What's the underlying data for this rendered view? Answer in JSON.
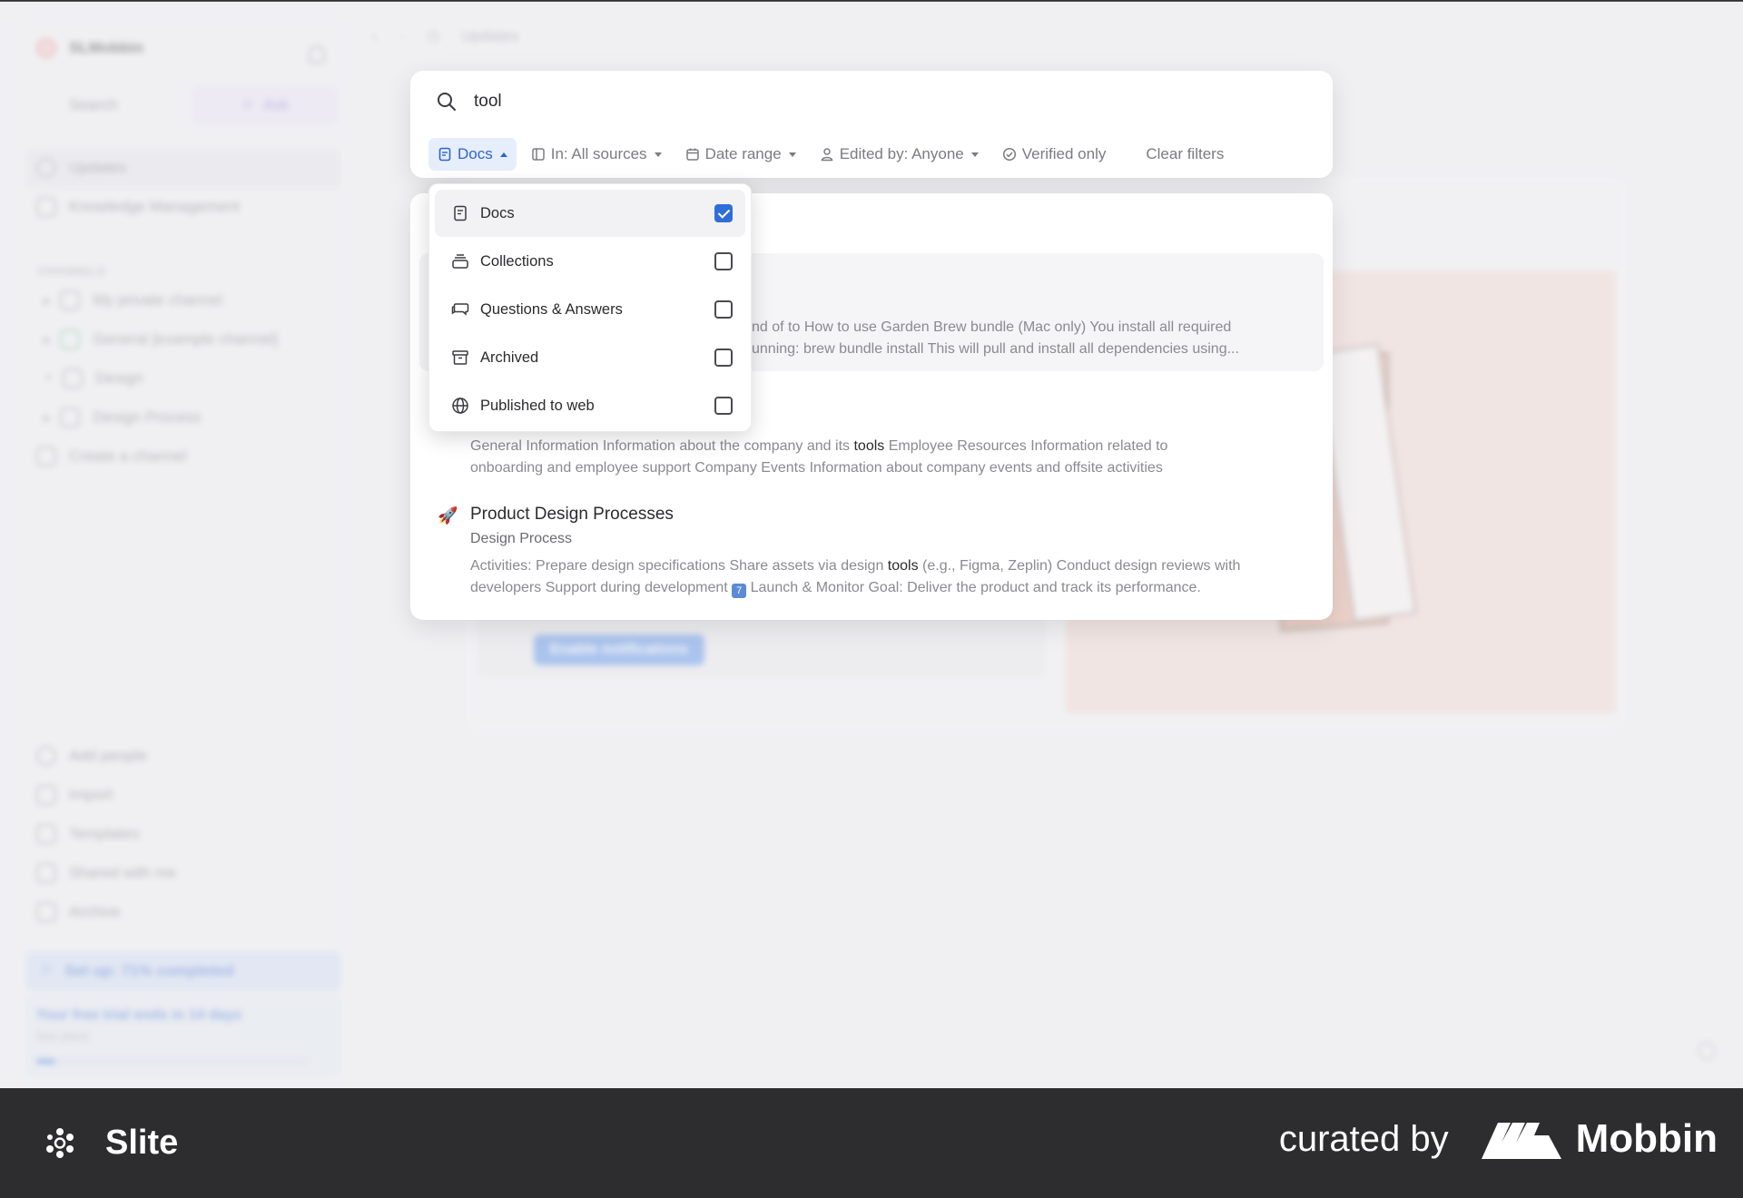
{
  "sidebar": {
    "workspace": "SLMobbin",
    "search_label": "Search",
    "ask_label": "Ask",
    "nav": [
      {
        "label": "Updates"
      },
      {
        "label": "Knowledge Management"
      }
    ],
    "section_label": "CHANNELS",
    "channels": [
      {
        "label": "My private channel"
      },
      {
        "label": "General [example channel]"
      },
      {
        "label": "Design"
      },
      {
        "label": "Design Process"
      },
      {
        "label": "Create a channel"
      }
    ],
    "bottom": [
      {
        "label": "Add people"
      },
      {
        "label": "Import"
      },
      {
        "label": "Templates"
      },
      {
        "label": "Shared with me"
      },
      {
        "label": "Archive"
      }
    ],
    "setup_label": "Set up: 71% completed",
    "trial_text": "Your free trial ends in 14 days",
    "trial_link": "See plans"
  },
  "topbar": {
    "page_title": "Updates"
  },
  "background": {
    "notif_button": "Enable notifications"
  },
  "search": {
    "query": "tool",
    "filters": [
      {
        "label": "Docs"
      },
      {
        "label": "In: All sources"
      },
      {
        "label": "Date range"
      },
      {
        "label": "Edited by: Anyone"
      },
      {
        "label": "Verified only"
      },
      {
        "label": "Clear filters"
      }
    ]
  },
  "dropdown": {
    "items": [
      {
        "label": "Docs",
        "checked": true
      },
      {
        "label": "Collections",
        "checked": false
      },
      {
        "label": "Questions & Answers",
        "checked": false
      },
      {
        "label": "Archived",
        "checked": false
      },
      {
        "label": "Published to web",
        "checked": false
      }
    ]
  },
  "results": [
    {
      "snippet_line1": "nd of to How to use Garden Brew bundle (Mac only) You install all required",
      "snippet_line2": "unning: brew bundle install This will pull and install all dependencies using..."
    },
    {
      "snippet_pre": "General Information Information about the company and its ",
      "snippet_highlight": "tools",
      "snippet_post": " Employee Resources Information related to",
      "snippet_line2": "onboarding and employee support Company Events Information about company events and offsite activities"
    },
    {
      "icon": "rocket-icon",
      "title": "Product Design Processes",
      "subtitle": "Design Process",
      "snippet_pre": "Activities: Prepare design specifications Share assets via design ",
      "snippet_highlight": "tools",
      "snippet_post": " (e.g., Figma, Zeplin) Conduct design reviews with",
      "snippet_line2_pre": "developers Support during development ",
      "badge": "7",
      "snippet_line2_post": " Launch & Monitor Goal: Deliver the product and track its performance."
    }
  ],
  "footer": {
    "brand": "Slite",
    "curated_by": "curated by",
    "curator": "Mobbin"
  }
}
